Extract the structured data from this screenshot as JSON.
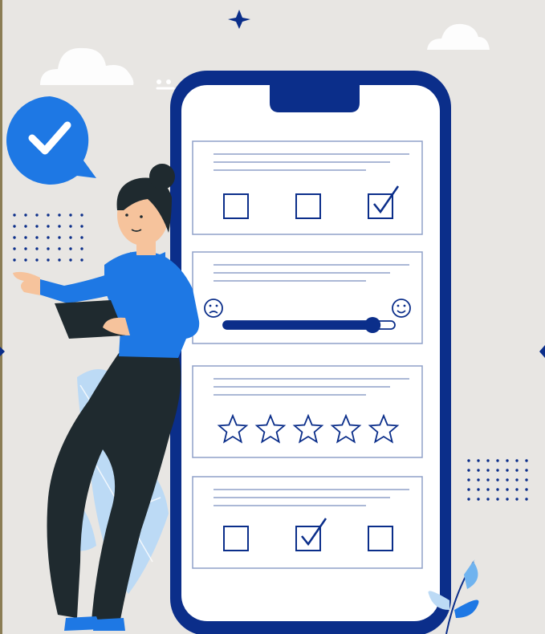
{
  "colors": {
    "background": "#e8e6e3",
    "phone_frame": "#0b2e8a",
    "phone_screen": "#ffffff",
    "accent_blue": "#1e78e4",
    "light_blue": "#bcdaf5",
    "dark_clothes": "#1f2a2f",
    "skin": "#f6c39c",
    "line_gray": "#8fa0c8"
  },
  "survey": {
    "cards": [
      {
        "type": "checkbox-row",
        "checked_index": 2,
        "count": 3
      },
      {
        "type": "slider",
        "value_fraction": 0.87,
        "min_icon": "sad-face-icon",
        "max_icon": "happy-face-icon"
      },
      {
        "type": "star-rating",
        "star_count": 5,
        "filled": 0
      },
      {
        "type": "checkbox-row",
        "checked_index": 1,
        "count": 3
      }
    ]
  },
  "icons": {
    "chat_badge": "checkmark-chat-bubble-icon",
    "sparkle": "sparkle-icon",
    "cloud": "cloud-icon",
    "plant": "leaf-plant-icon"
  }
}
